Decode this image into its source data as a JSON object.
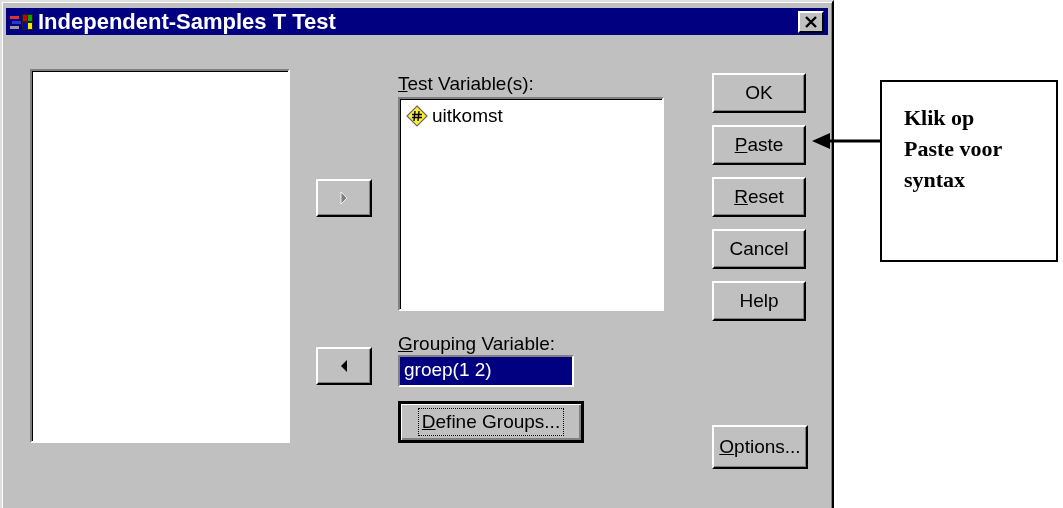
{
  "window": {
    "title": "Independent-Samples T Test"
  },
  "transfer_buttons": [
    {
      "kind": "right",
      "disabled": true
    },
    {
      "kind": "left",
      "disabled": false
    }
  ],
  "test_variables": {
    "label": "Test Variable(s):",
    "underlined": true,
    "items": [
      {
        "name": "uitkomst"
      }
    ]
  },
  "grouping_variable": {
    "label": "Grouping Variable:",
    "underlined": true,
    "value": "groep(1 2)",
    "selected": true
  },
  "define_groups": {
    "label": "Define Groups...",
    "underlined": true,
    "focused": true
  },
  "buttons": [
    {
      "label": "OK",
      "underlined": false
    },
    {
      "label": "Paste",
      "underlined": true
    },
    {
      "label": "Reset",
      "underlined": true
    },
    {
      "label": "Cancel",
      "underlined": false
    },
    {
      "label": "Help",
      "underlined": false
    }
  ],
  "options": {
    "label": "Options...",
    "underlined": true
  },
  "callout": {
    "text": "Klik op Paste voor syntax"
  }
}
